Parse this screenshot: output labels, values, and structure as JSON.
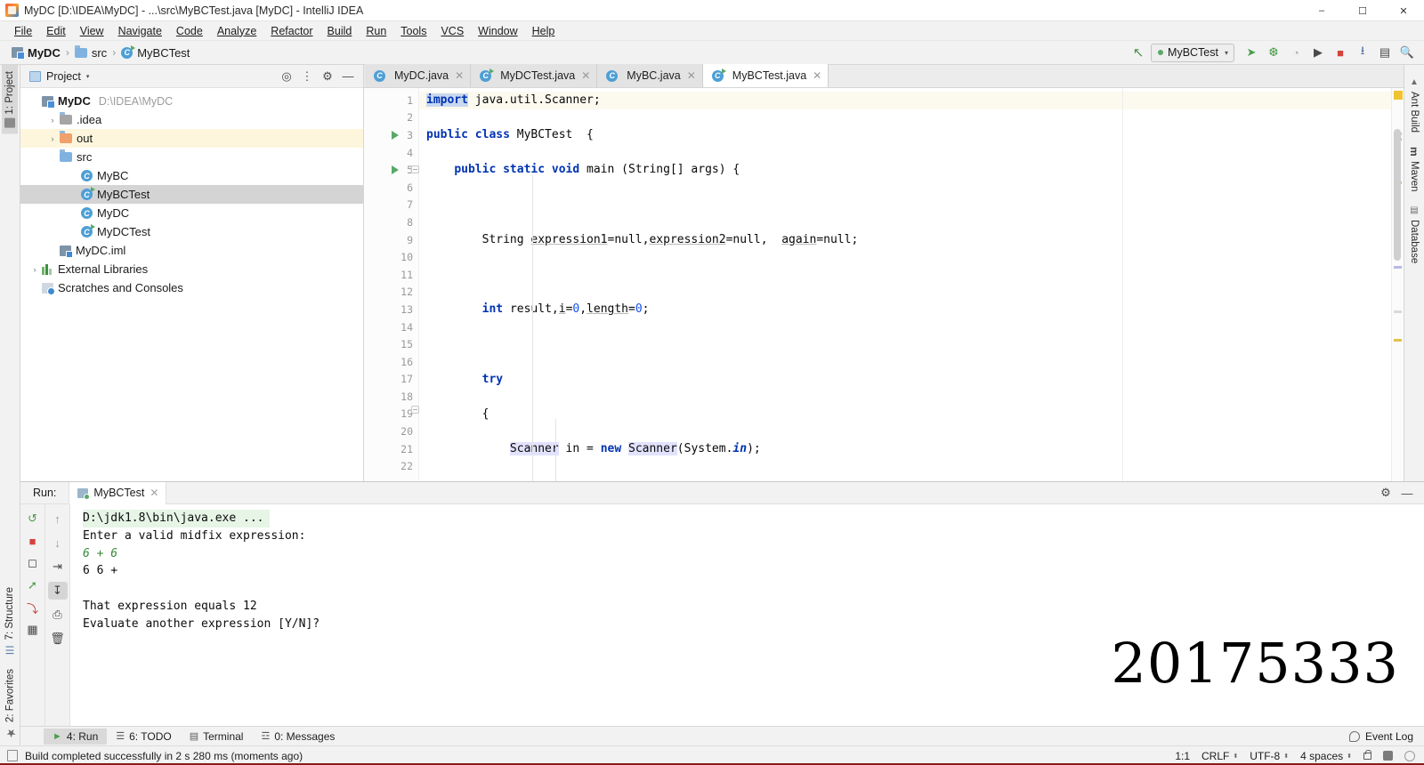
{
  "window": {
    "title": "MyDC [D:\\IDEA\\MyDC] - ...\\src\\MyBCTest.java [MyDC] - IntelliJ IDEA",
    "minimize": "–",
    "maximize": "☐",
    "close": "✕"
  },
  "menu": [
    {
      "label": "File"
    },
    {
      "label": "Edit"
    },
    {
      "label": "View"
    },
    {
      "label": "Navigate"
    },
    {
      "label": "Code"
    },
    {
      "label": "Analyze"
    },
    {
      "label": "Refactor"
    },
    {
      "label": "Build"
    },
    {
      "label": "Run"
    },
    {
      "label": "Tools"
    },
    {
      "label": "VCS"
    },
    {
      "label": "Window"
    },
    {
      "label": "Help"
    }
  ],
  "breadcrumb": {
    "items": [
      "MyDC",
      "src",
      "MyBCTest"
    ],
    "sep": "›"
  },
  "toolbar": {
    "build_hammer": "↖",
    "run_config": "MyBCTest",
    "chevron": "▾",
    "run": "➤",
    "debug": "❆",
    "coverage": "◔",
    "profile": "▶",
    "stop": "■",
    "update": "⭳",
    "search_everywhere": "🔍",
    "layout": "▤"
  },
  "left_rail": [
    {
      "label": "1: Project",
      "active": true
    },
    {
      "label": "7: Structure",
      "active": false
    },
    {
      "label": "2: Favorites",
      "active": false
    }
  ],
  "right_rail": [
    {
      "label": "Ant Build"
    },
    {
      "label": "Maven"
    },
    {
      "label": "Database"
    }
  ],
  "project_panel": {
    "title": "Project",
    "chevron": "▾",
    "buttons": [
      "locate-icon",
      "collapse-all-icon",
      "settings-icon",
      "hide-icon"
    ],
    "tree": [
      {
        "indent": 0,
        "twisty": "ⱟ",
        "icon": "module",
        "label": "MyDC",
        "bold": true,
        "sub": "D:\\IDEA\\MyDC",
        "state": "normal"
      },
      {
        "indent": 1,
        "twisty": "›",
        "icon": "folder-idea",
        "label": ".idea",
        "bold": false,
        "sub": "",
        "state": "normal"
      },
      {
        "indent": 1,
        "twisty": "›",
        "icon": "folder-out",
        "label": "out",
        "bold": false,
        "sub": "",
        "state": "highlight"
      },
      {
        "indent": 1,
        "twisty": "ⱟ",
        "icon": "folder-src",
        "label": "src",
        "bold": false,
        "sub": "",
        "state": "normal"
      },
      {
        "indent": 2,
        "twisty": "",
        "icon": "class",
        "label": "MyBC",
        "bold": false,
        "sub": "",
        "state": "normal"
      },
      {
        "indent": 2,
        "twisty": "",
        "icon": "class-runnable",
        "label": "MyBCTest",
        "bold": false,
        "sub": "",
        "state": "selected"
      },
      {
        "indent": 2,
        "twisty": "",
        "icon": "class",
        "label": "MyDC",
        "bold": false,
        "sub": "",
        "state": "normal"
      },
      {
        "indent": 2,
        "twisty": "",
        "icon": "class-runnable",
        "label": "MyDCTest",
        "bold": false,
        "sub": "",
        "state": "normal"
      },
      {
        "indent": 1,
        "twisty": "",
        "icon": "iml",
        "label": "MyDC.iml",
        "bold": false,
        "sub": "",
        "state": "normal"
      },
      {
        "indent": 0,
        "twisty": "›",
        "icon": "library",
        "label": "External Libraries",
        "bold": false,
        "sub": "",
        "state": "normal"
      },
      {
        "indent": 0,
        "twisty": "",
        "icon": "scratch",
        "label": "Scratches and Consoles",
        "bold": false,
        "sub": "",
        "state": "normal"
      }
    ]
  },
  "editor": {
    "tabs": [
      {
        "label": "MyDC.java",
        "icon": "class",
        "active": false
      },
      {
        "label": "MyDCTest.java",
        "icon": "class-runnable",
        "active": false
      },
      {
        "label": "MyBC.java",
        "icon": "class",
        "active": false
      },
      {
        "label": "MyBCTest.java",
        "icon": "class-runnable",
        "active": true
      }
    ],
    "close_glyph": "✕",
    "line_numbers": [
      "1",
      "2",
      "3",
      "4",
      "5",
      "6",
      "7",
      "8",
      "9",
      "10",
      "11",
      "12",
      "13",
      "14",
      "15",
      "16",
      "17",
      "18",
      "19",
      "20",
      "21",
      "22"
    ],
    "lines": [
      {
        "n": 1,
        "text": "import java.util.Scanner;",
        "current": true
      },
      {
        "n": 2,
        "text": "",
        "current": false
      },
      {
        "n": 3,
        "text": "public class MyBCTest  {",
        "current": false
      },
      {
        "n": 4,
        "text": "",
        "current": false
      },
      {
        "n": 5,
        "text": "    public static void main (String[] args) {",
        "current": false
      },
      {
        "n": 6,
        "text": "",
        "current": false
      },
      {
        "n": 7,
        "text": "",
        "current": false
      },
      {
        "n": 8,
        "text": "",
        "current": false
      },
      {
        "n": 9,
        "text": "        String expression1=null,expression2=null,  again=null;",
        "current": false
      },
      {
        "n": 10,
        "text": "",
        "current": false
      },
      {
        "n": 11,
        "text": "",
        "current": false
      },
      {
        "n": 12,
        "text": "",
        "current": false
      },
      {
        "n": 13,
        "text": "        int result,i=0,length=0;",
        "current": false
      },
      {
        "n": 14,
        "text": "",
        "current": false
      },
      {
        "n": 15,
        "text": "",
        "current": false
      },
      {
        "n": 16,
        "text": "",
        "current": false
      },
      {
        "n": 17,
        "text": "        try",
        "current": false
      },
      {
        "n": 18,
        "text": "",
        "current": false
      },
      {
        "n": 19,
        "text": "        {",
        "current": false
      },
      {
        "n": 20,
        "text": "",
        "current": false
      },
      {
        "n": 21,
        "text": "            Scanner in = new Scanner(System.in);",
        "current": false
      },
      {
        "n": 22,
        "text": "",
        "current": false
      }
    ]
  },
  "run_panel": {
    "title": "Run:",
    "tab_label": "MyBCTest",
    "close_glyph": "✕",
    "settings_glyph": "⚙",
    "hide_glyph": "—",
    "left_tools": [
      "rerun-icon",
      "stop-icon",
      "camera-icon",
      "thread-dump-icon",
      "export-icon",
      "console-icon"
    ],
    "right_tools": [
      "scroll-up-icon",
      "scroll-down-icon",
      "soft-wrap-icon",
      "scroll-to-end-icon",
      "print-icon",
      "clear-all-icon"
    ],
    "console_lines": [
      {
        "text": "D:\\jdk1.8\\bin\\java.exe ...",
        "style": "head"
      },
      {
        "text": "Enter a valid midfix expression:",
        "style": "normal"
      },
      {
        "text": "6 + 6",
        "style": "input"
      },
      {
        "text": "6 6 +",
        "style": "normal"
      },
      {
        "text": "",
        "style": "normal"
      },
      {
        "text": "That expression equals 12",
        "style": "normal"
      },
      {
        "text": "Evaluate another expression [Y/N]?",
        "style": "normal"
      }
    ],
    "watermark": "20175333"
  },
  "bottom_tabs": [
    {
      "label": "4: Run",
      "icon": "play-icon",
      "active": true
    },
    {
      "label": "6: TODO",
      "icon": "list-icon",
      "active": false
    },
    {
      "label": "Terminal",
      "icon": "terminal-icon",
      "active": false
    },
    {
      "label": "0: Messages",
      "icon": "messages-icon",
      "active": false
    }
  ],
  "event_log": "Event Log",
  "status": {
    "message": "Build completed successfully in 2 s 280 ms (moments ago)",
    "caret": "1:1",
    "line_separator": "CRLF",
    "encoding": "UTF-8",
    "indent": "4 spaces",
    "chevron": "⬍"
  }
}
